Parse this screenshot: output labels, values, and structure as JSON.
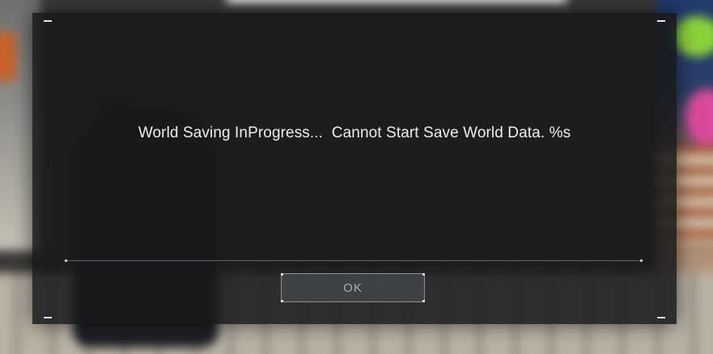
{
  "dialog": {
    "message": "World Saving InProgress...  Cannot Start Save World Data. %s",
    "ok_label": "OK"
  },
  "colors": {
    "panel": "#16181a",
    "text": "#eeeeee",
    "button_text": "#a9adb1",
    "button_border": "#8a8f94"
  }
}
